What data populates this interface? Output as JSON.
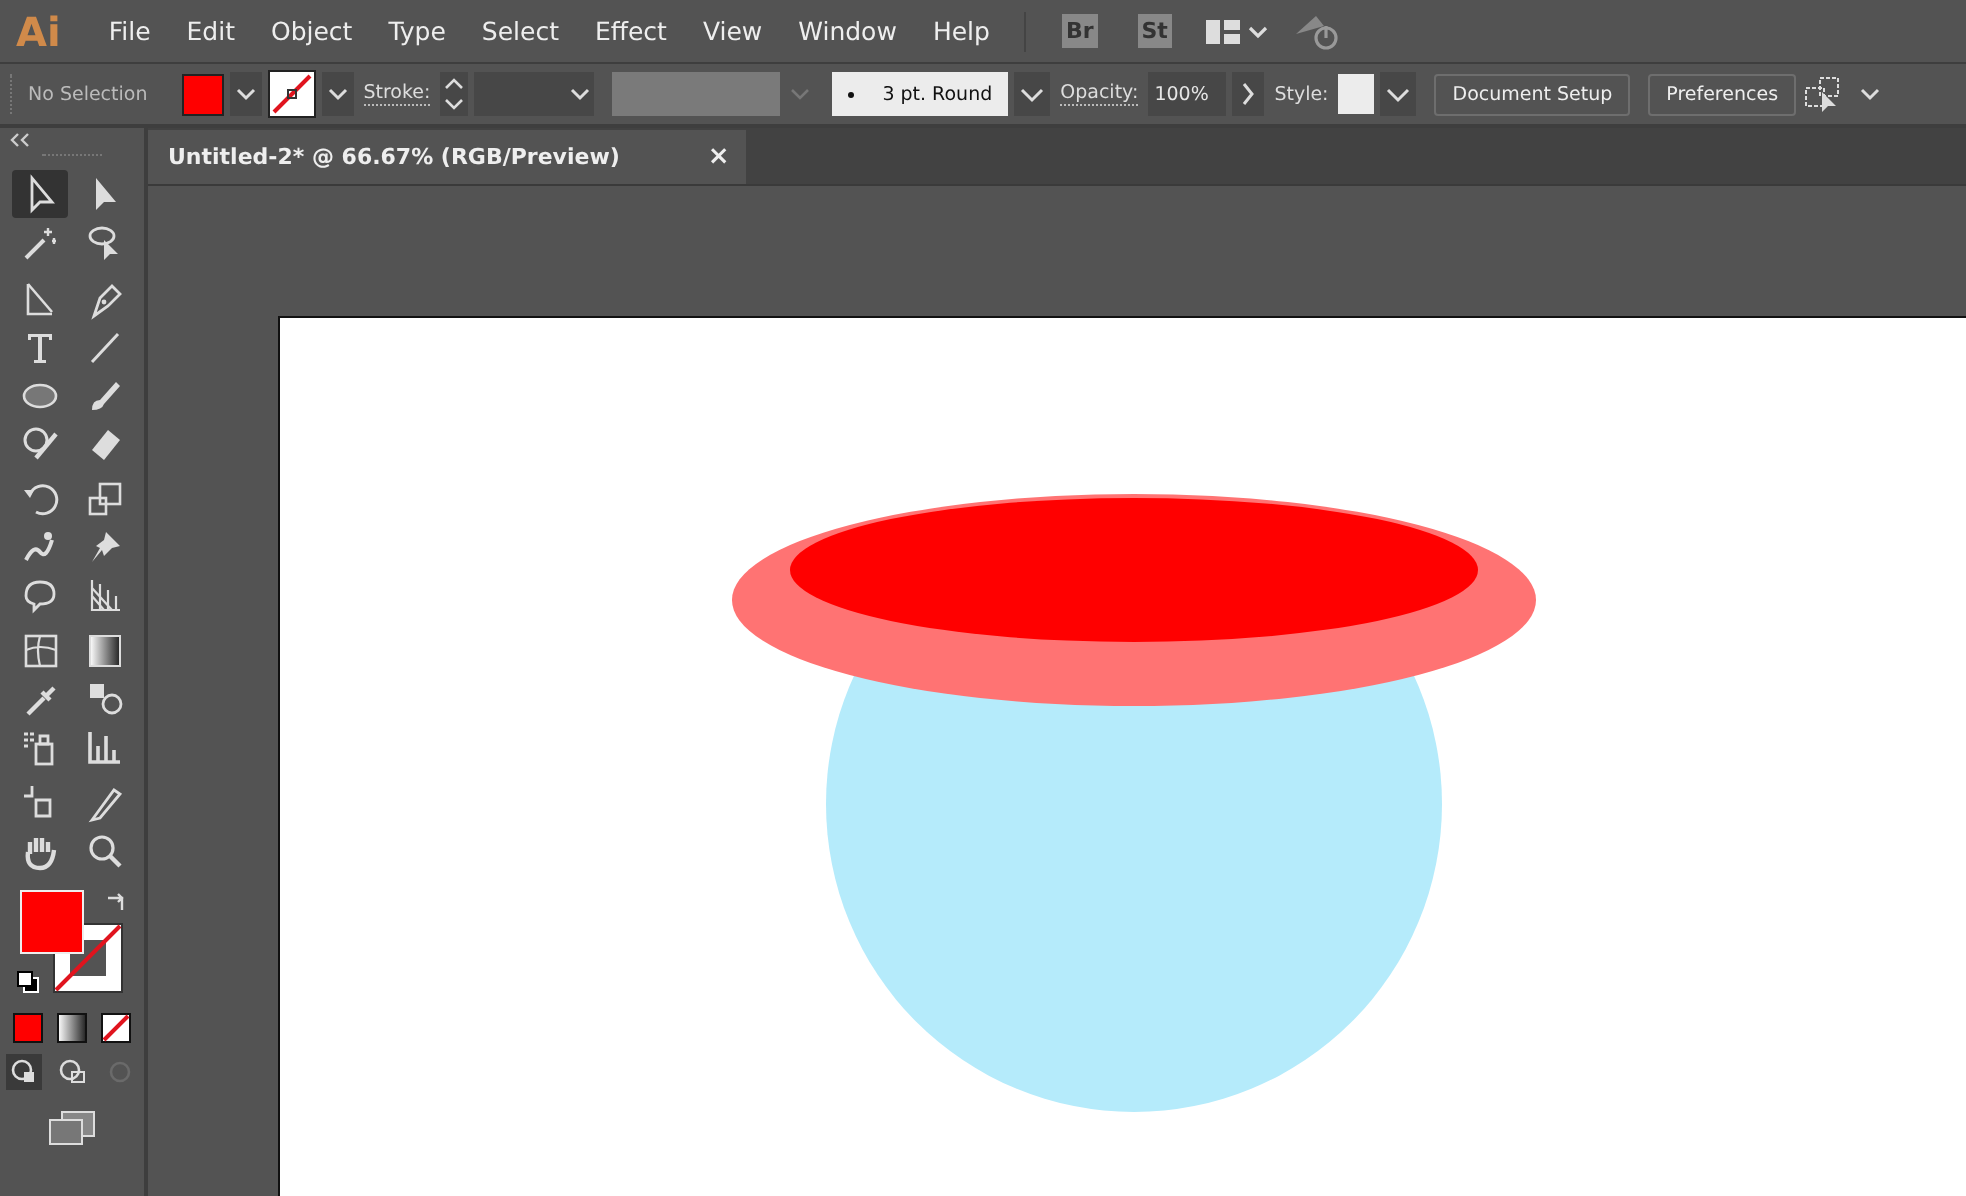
{
  "menu_bar": {
    "logo": "Ai",
    "items": [
      "File",
      "Edit",
      "Object",
      "Type",
      "Select",
      "Effect",
      "View",
      "Window",
      "Help"
    ],
    "bridge": "Br",
    "stock": "St"
  },
  "control_bar": {
    "selection": "No Selection",
    "fill": {
      "color": "#ff0000"
    },
    "stroke_none": true,
    "stroke_label": "Stroke:",
    "brush": "3 pt. Round",
    "opacity_label": "Opacity:",
    "opacity": "100%",
    "style_label": "Style:",
    "buttons": [
      "Document Setup",
      "Preferences"
    ]
  },
  "document_tab": {
    "title": "Untitled-2* @ 66.67% (RGB/Preview)",
    "close": "×"
  },
  "toolbar": {
    "tools": [
      {
        "selected": true
      },
      {
        "selected": false
      },
      {
        "selected": false
      },
      {
        "selected": false
      },
      {
        "selected": false
      },
      {
        "selected": false
      },
      {
        "selected": false
      },
      {
        "selected": false
      },
      {
        "selected": false
      },
      {
        "selected": false
      },
      {
        "selected": false
      },
      {
        "selected": false
      },
      {
        "selected": false
      },
      {
        "selected": false
      },
      {
        "selected": false
      },
      {
        "selected": false
      },
      {
        "selected": false
      },
      {
        "selected": false
      },
      {
        "selected": false
      },
      {
        "selected": false
      },
      {
        "selected": false
      },
      {
        "selected": false
      },
      {
        "selected": false
      },
      {
        "selected": false
      },
      {
        "selected": false
      },
      {
        "selected": false
      },
      {
        "selected": false
      },
      {
        "selected": false
      }
    ],
    "fill": {
      "color": "#ff0000"
    },
    "stroke_none": true
  }
}
